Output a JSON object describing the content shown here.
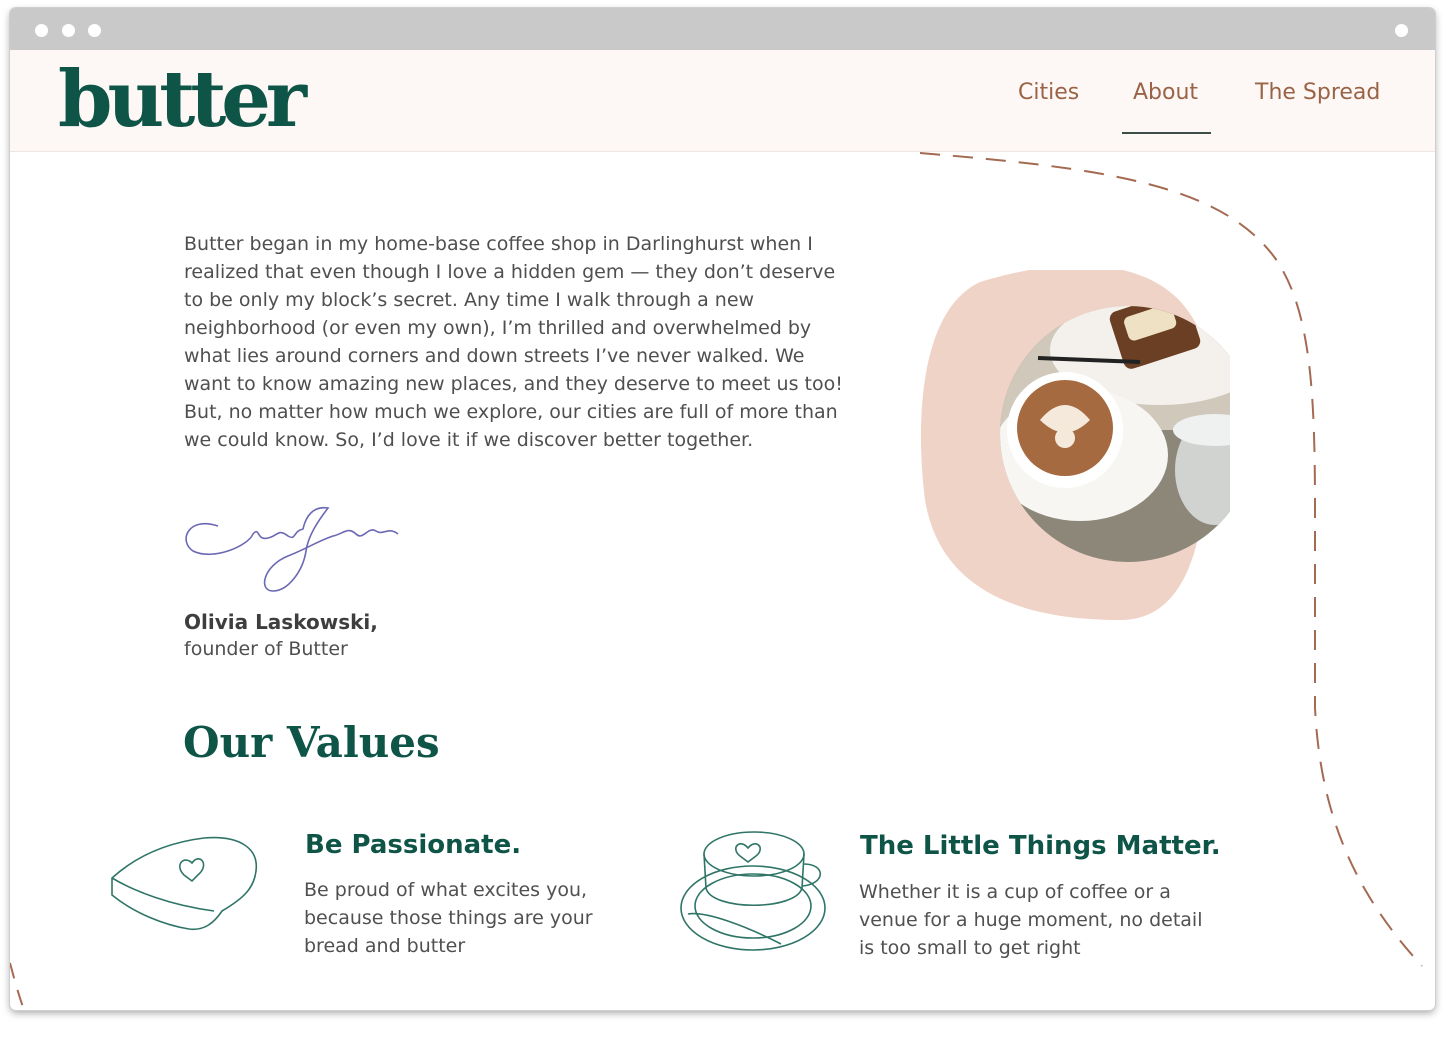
{
  "brand": {
    "logo": "butter",
    "accent": "#0e5547",
    "nav_color": "#9a6346",
    "blob_color": "#f0d3c7"
  },
  "nav": {
    "items": [
      {
        "label": "Cities",
        "active": false
      },
      {
        "label": "About",
        "active": true
      },
      {
        "label": "The Spread",
        "active": false
      }
    ]
  },
  "letter": {
    "body": "Butter began in my home-base coffee shop in Darlinghurst when I realized that even though I love a hidden gem — they don’t deserve to be only my block’s secret. Any time I walk through a new neighborhood (or even my own), I’m thrilled and overwhelmed by what lies around corners and down streets I’ve never walked. We want to know amazing new places, and they deserve to meet us too! But, no matter how much we explore, our cities are full of more than we could know. So, I’d love it if we discover better together.",
    "signature_name": "Olivia Laskowski,",
    "signature_role": "founder of Butter"
  },
  "values": {
    "title": "Our Values",
    "items": [
      {
        "icon": "toast-icon",
        "title": "Be Passionate.",
        "text": "Be proud of what excites you, because those things are your bread and butter"
      },
      {
        "icon": "coffee-cup-icon",
        "title": "The Little Things Matter.",
        "text": "Whether it is a cup of coffee or a venue for a huge moment, no detail is too small to get right"
      }
    ]
  }
}
